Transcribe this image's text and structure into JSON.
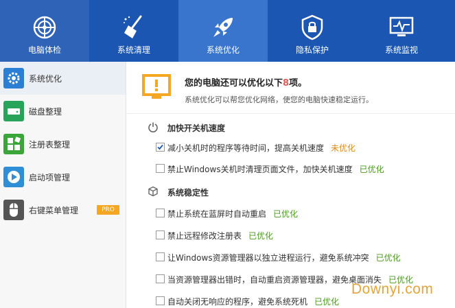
{
  "nav": {
    "tabs": [
      {
        "label": "电脑体检",
        "icon": "radar-icon"
      },
      {
        "label": "系统清理",
        "icon": "broom-icon"
      },
      {
        "label": "系统优化",
        "icon": "rocket-icon",
        "active": true
      },
      {
        "label": "隐私保护",
        "icon": "lock-shield-icon"
      },
      {
        "label": "系统监视",
        "icon": "monitor-pulse-icon"
      }
    ]
  },
  "sidebar": {
    "items": [
      {
        "label": "系统优化",
        "icon": "gear-icon",
        "color": "#2a7fd4",
        "active": true
      },
      {
        "label": "磁盘整理",
        "icon": "disk-icon",
        "color": "#27a35a"
      },
      {
        "label": "注册表整理",
        "icon": "grid-icon",
        "color": "#3aa63a"
      },
      {
        "label": "启动项管理",
        "icon": "play-icon",
        "color": "#2f8fd6"
      },
      {
        "label": "右键菜单管理",
        "icon": "mouse-icon",
        "color": "#555555",
        "badge": "PRO"
      }
    ]
  },
  "summary": {
    "headline_pre": "您的电脑还可以优化以下",
    "count": "8",
    "headline_post": "项。",
    "description": "系统优化可以帮您优化网络，使您的电脑快速稳定运行。"
  },
  "sections": [
    {
      "title": "加快开关机速度",
      "icon": "power-icon",
      "options": [
        {
          "text": "减小关机时的程序等待时间，提高关机速度",
          "status": "未优化",
          "state": "pending",
          "checked": true
        },
        {
          "text": "禁止Windows关机时清理页面文件，加快关机速度",
          "status": "已优化",
          "state": "done",
          "checked": false
        }
      ]
    },
    {
      "title": "系统稳定性",
      "icon": "cube-icon",
      "options": [
        {
          "text": "禁止系统在蓝屏时自动重启",
          "status": "已优化",
          "state": "done",
          "checked": false
        },
        {
          "text": "禁止远程修改注册表",
          "status": "已优化",
          "state": "done",
          "checked": false
        },
        {
          "text": "让Windows资源管理器以独立进程运行，避免系统冲突",
          "status": "已优化",
          "state": "done",
          "checked": false
        },
        {
          "text": "当资源管理器出错时，自动重启资源管理器，避免桌面消失",
          "status": "已优化",
          "state": "done",
          "checked": false
        },
        {
          "text": "自动关闭无响应的程序，避免系统死机",
          "status": "已优化",
          "state": "done",
          "checked": false
        }
      ]
    }
  ],
  "watermark": "Downyi.com",
  "colors": {
    "topbar": "#1b56b3",
    "active_tab": "#3a75cd",
    "pending": "#e08b12",
    "done": "#4a9a1e",
    "highlight": "#e85a5a"
  }
}
